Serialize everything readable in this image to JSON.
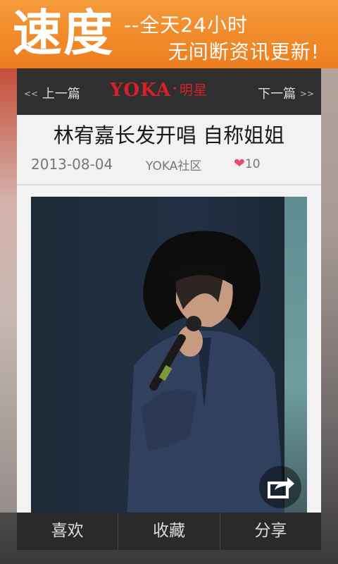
{
  "promo": {
    "big_text": "速度",
    "line1": "--全天24小时",
    "line2": "无间断资讯更新!"
  },
  "header": {
    "prev_label": "上一篇",
    "next_label": "下一篇",
    "logo_brand": "YOKA",
    "logo_dot": "·",
    "logo_section": "明星",
    "prev_icon": "double-chevron-left",
    "next_icon": "double-chevron-right"
  },
  "article": {
    "title": "林宥嘉长发开唱 自称姐姐",
    "date": "2013-08-04",
    "source": "YOKA社区",
    "likes": "10",
    "like_icon": "heart"
  },
  "bottom_bar": {
    "items": [
      "喜欢",
      "收藏",
      "分享"
    ]
  },
  "colors": {
    "promo_orange": "#ee7d1d",
    "logo_red": "#d7202a",
    "heart_pink": "#e94b6c",
    "bar_dark": "#2f2f2f"
  }
}
